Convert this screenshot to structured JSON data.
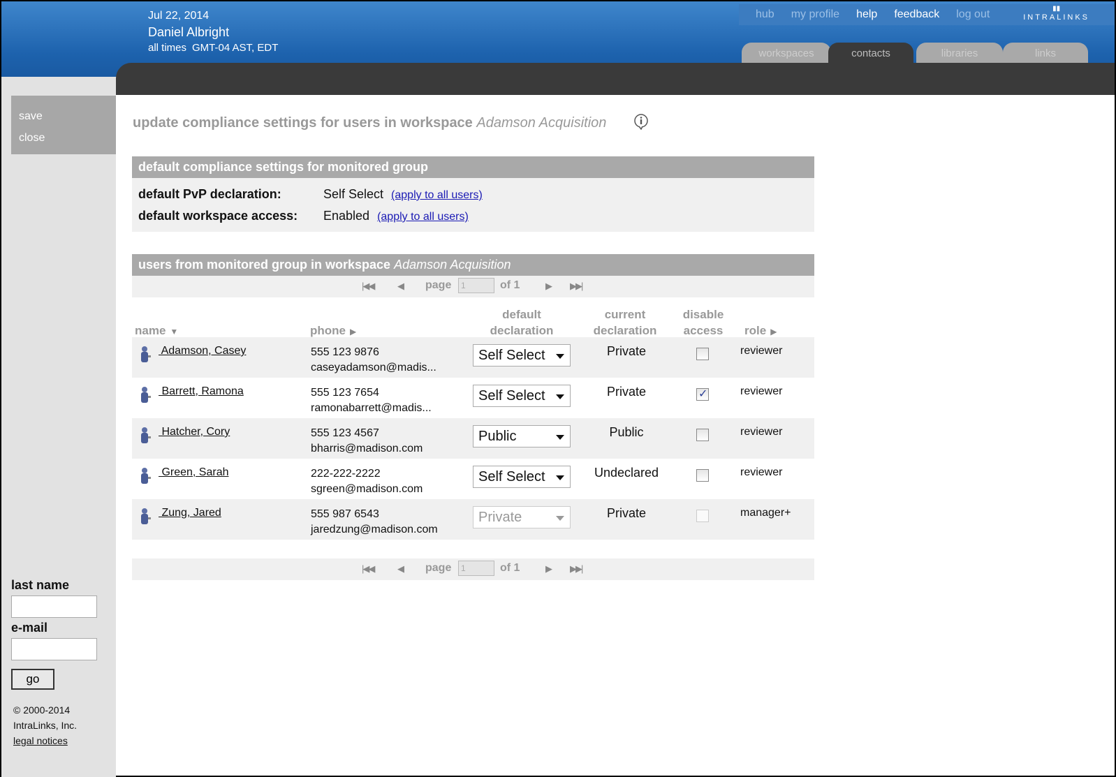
{
  "header": {
    "date": "Jul 22, 2014",
    "user": "Daniel Albright",
    "tz_label": "all times",
    "tz_value": "GMT-04 AST, EDT",
    "logo": "INTRALINKS",
    "links": [
      "hub",
      "my profile",
      "help",
      "feedback",
      "log out"
    ],
    "tabs": [
      "workspaces",
      "contacts",
      "libraries",
      "links"
    ]
  },
  "rail": {
    "menu": [
      "save",
      "close"
    ],
    "last_name_label": "last name",
    "email_label": "e-mail",
    "go_label": "go",
    "copyright": "© 2000-2014",
    "company": "IntraLinks, Inc.",
    "legal": "legal notices"
  },
  "page": {
    "title": "update compliance settings for users in workspace",
    "workspace": "Adamson Acquisition"
  },
  "defaults": {
    "header": "default compliance settings for monitored group",
    "pvp_label": "default PvP declaration:",
    "pvp_value": "Self Select",
    "access_label": "default workspace access:",
    "access_value": "Enabled",
    "apply_link": "(apply to all users)"
  },
  "users_panel": {
    "header": "users from monitored group in workspace",
    "workspace": "Adamson Acquisition"
  },
  "pager": {
    "page_label": "page",
    "page_value": "1",
    "of_label": "of 1"
  },
  "columns": {
    "name": "name",
    "phone": "phone",
    "default_decl_1": "default",
    "default_decl_2": "declaration",
    "current_decl_1": "current",
    "current_decl_2": "declaration",
    "disable_1": "disable",
    "disable_2": "access",
    "role": "role"
  },
  "users": [
    {
      "name": " Adamson, Casey",
      "phone": "555 123 9876",
      "email": "caseyadamson@madis...",
      "default": "Self Select",
      "current": "Private",
      "role": "reviewer"
    },
    {
      "name": " Barrett, Ramona",
      "phone": "555 123 7654",
      "email": "ramonabarrett@madis...",
      "default": "Self Select",
      "current": "Private",
      "role": "reviewer"
    },
    {
      "name": " Hatcher, Cory",
      "phone": "555 123 4567",
      "email": "bharris@madison.com",
      "default": "Public",
      "current": "Public",
      "role": "reviewer"
    },
    {
      "name": " Green, Sarah",
      "phone": "222-222-2222",
      "email": "sgreen@madison.com",
      "default": "Self Select",
      "current": "Undeclared",
      "role": "reviewer"
    },
    {
      "name": " Zung, Jared",
      "phone": "555 987 6543",
      "email": "jaredzung@madison.com",
      "default": "Private",
      "current": "Private",
      "role": "manager+"
    }
  ]
}
